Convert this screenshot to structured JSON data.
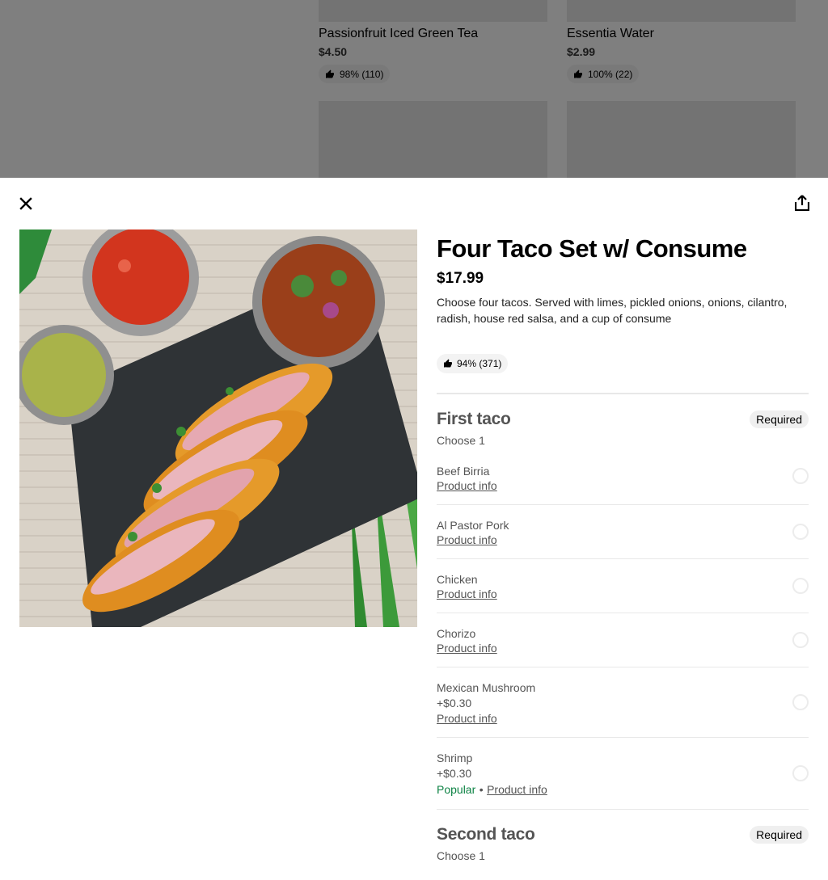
{
  "background": {
    "cards": [
      {
        "name": "Passionfruit Iced Green Tea",
        "price": "$4.50",
        "rating": "98% (110)"
      },
      {
        "name": "Essentia Water",
        "price": "$2.99",
        "rating": "100% (22)"
      }
    ]
  },
  "modal": {
    "close_icon": "close-icon",
    "share_icon": "share-icon",
    "item": {
      "title": "Four Taco Set w/ Consume",
      "price": "$17.99",
      "description": "Choose four tacos. Served with limes, pickled onions, onions, cilantro, radish, house red salsa, and a cup of consume",
      "rating": "94% (371)"
    },
    "groups": [
      {
        "title": "First taco",
        "subtitle": "Choose 1",
        "badge": "Required",
        "options": [
          {
            "name": "Beef Birria",
            "link": "Product info"
          },
          {
            "name": "Al Pastor Pork",
            "link": "Product info"
          },
          {
            "name": "Chicken",
            "link": "Product info"
          },
          {
            "name": "Chorizo",
            "link": "Product info"
          },
          {
            "name": "Mexican Mushroom",
            "price": "+$0.30",
            "link": "Product info"
          },
          {
            "name": "Shrimp",
            "price": "+$0.30",
            "popular": "Popular",
            "separator": "•",
            "link": "Product info"
          }
        ]
      },
      {
        "title": "Second taco",
        "subtitle": "Choose 1",
        "badge": "Required"
      }
    ]
  },
  "colors": {
    "popular_green": "#0e8345",
    "muted_text": "#545454",
    "chip_bg": "#f3f3f3"
  }
}
